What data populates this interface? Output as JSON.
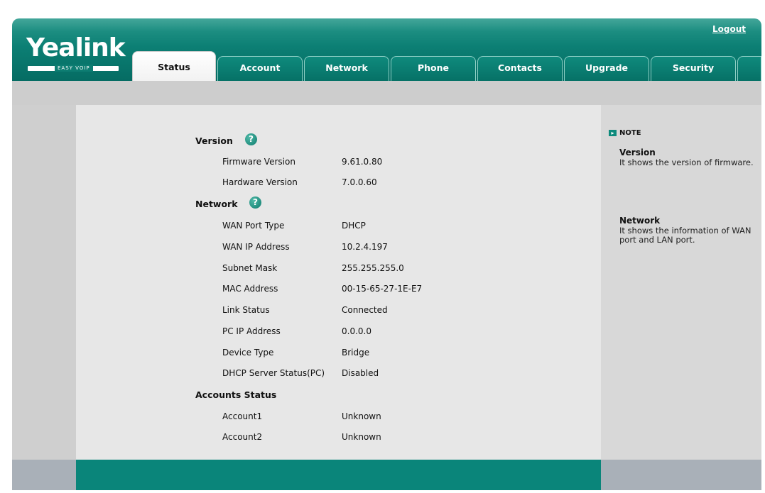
{
  "brand": {
    "logo_text": "Yealink",
    "logo_sub": "EASY VOIP"
  },
  "header": {
    "logout_label": "Logout"
  },
  "tabs": [
    {
      "label": "Status"
    },
    {
      "label": "Account"
    },
    {
      "label": "Network"
    },
    {
      "label": "Phone"
    },
    {
      "label": "Contacts"
    },
    {
      "label": "Upgrade"
    },
    {
      "label": "Security"
    }
  ],
  "active_tab": "Status",
  "version": {
    "title": "Version",
    "rows": [
      {
        "label": "Firmware Version",
        "value": "9.61.0.80"
      },
      {
        "label": "Hardware Version",
        "value": "7.0.0.60"
      }
    ]
  },
  "network": {
    "title": "Network",
    "rows": [
      {
        "label": "WAN Port Type",
        "value": "DHCP"
      },
      {
        "label": "WAN IP Address",
        "value": "10.2.4.197"
      },
      {
        "label": "Subnet Mask",
        "value": "255.255.255.0"
      },
      {
        "label": "MAC Address",
        "value": "00-15-65-27-1E-E7"
      },
      {
        "label": "Link Status",
        "value": "Connected"
      },
      {
        "label": "PC IP Address",
        "value": "0.0.0.0"
      },
      {
        "label": "Device Type",
        "value": "Bridge"
      },
      {
        "label": "DHCP Server Status(PC)",
        "value": "Disabled"
      }
    ]
  },
  "accounts": {
    "title": "Accounts Status",
    "rows": [
      {
        "label": "Account1",
        "value": "Unknown"
      },
      {
        "label": "Account2",
        "value": "Unknown"
      }
    ]
  },
  "note": {
    "heading": "NOTE",
    "items": [
      {
        "title": "Version",
        "text": "It shows the version of firmware."
      },
      {
        "title": "Network",
        "text": "It shows the information of WAN port and LAN port."
      }
    ]
  },
  "colors": {
    "brand_teal": "#0a857a",
    "tab_teal": "#067166"
  }
}
